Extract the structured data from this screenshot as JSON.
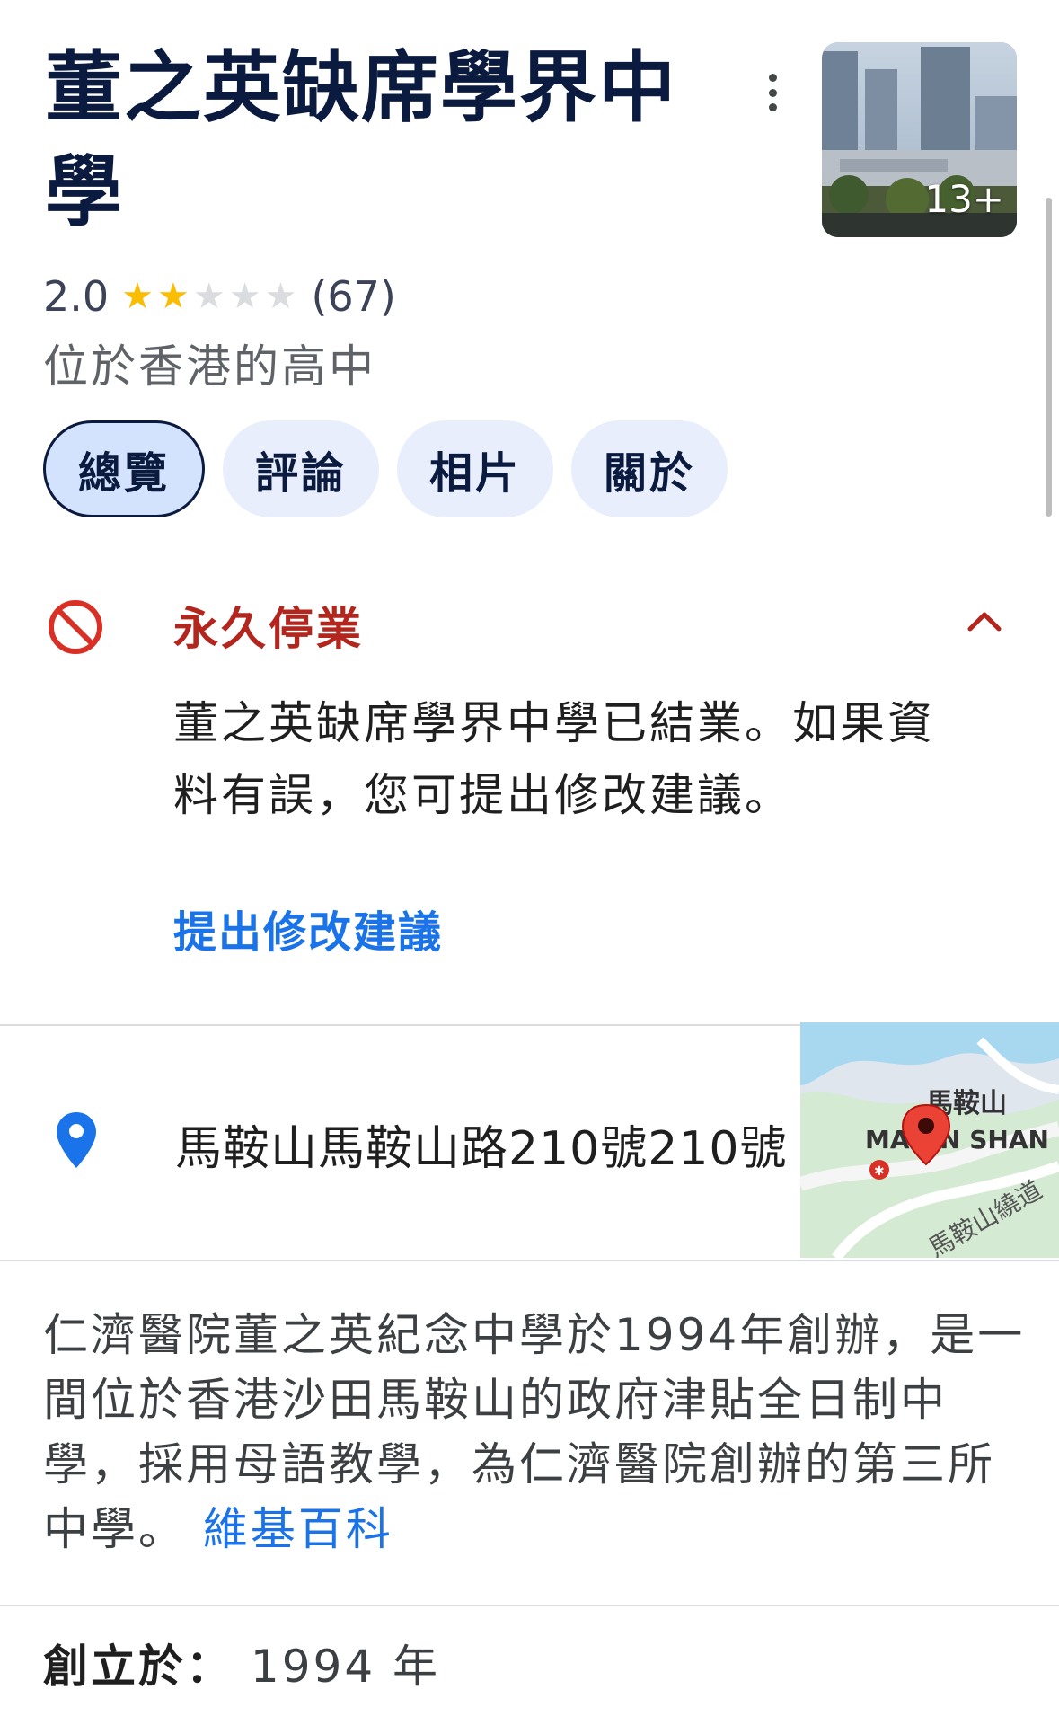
{
  "place": {
    "title": "董之英缺席學界中學",
    "rating": "2.0",
    "stars_filled": 2,
    "stars_total": 5,
    "review_count": "(67)",
    "category": "位於香港的高中",
    "photo_count": "13+"
  },
  "tabs": [
    {
      "label": "總覽",
      "active": true
    },
    {
      "label": "評論",
      "active": false
    },
    {
      "label": "相片",
      "active": false
    },
    {
      "label": "關於",
      "active": false
    }
  ],
  "closed_notice": {
    "title": "永久停業",
    "body": "董之英缺席學界中學已結業。如果資料有誤，您可提出修改建議。",
    "link": "提出修改建議"
  },
  "address": {
    "text": "馬鞍山馬鞍山路210號210號",
    "map_labels": [
      "馬鞍山",
      "MA ON SHAN",
      "馬鞍山繞道"
    ]
  },
  "description": {
    "text": "仁濟醫院董之英紀念中學於1994年創辦，是一間位於香港沙田馬鞍山的政府津貼全日制中學，採用母語教學，為仁濟醫院創辦的第三所中學。",
    "source_link": "維基百科"
  },
  "founded": {
    "label": "創立於：",
    "value": "1994 年"
  },
  "colors": {
    "closed_red": "#b3261e",
    "link_blue": "#1a73e8",
    "star_gold": "#fbbc04",
    "tab_bg": "#e8eefc"
  }
}
